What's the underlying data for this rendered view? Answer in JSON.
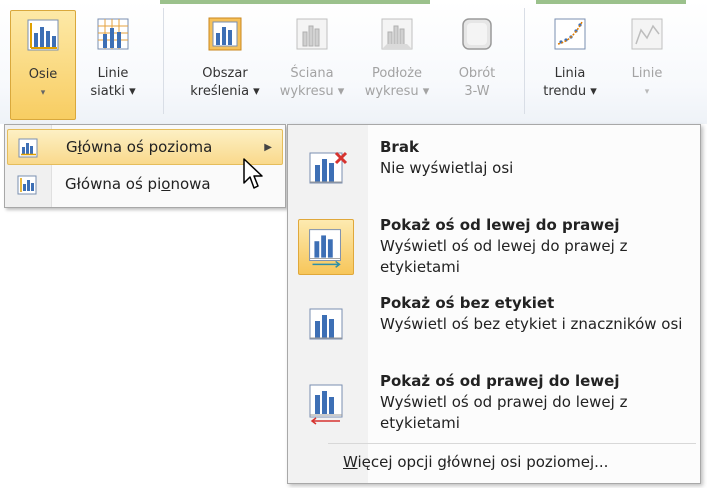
{
  "ribbon": {
    "buttons": [
      {
        "id": "osie",
        "line1": "Osie",
        "line2": "▾",
        "state": "active"
      },
      {
        "id": "linie-siatki",
        "line1": "Linie",
        "line2": "siatki ▾",
        "state": "normal"
      },
      {
        "id": "obszar",
        "line1": "Obszar",
        "line2": "kreślenia ▾",
        "state": "normal"
      },
      {
        "id": "sciana",
        "line1": "Ściana",
        "line2": "wykresu ▾",
        "state": "disabled"
      },
      {
        "id": "podloze",
        "line1": "Podłoże",
        "line2": "wykresu ▾",
        "state": "disabled"
      },
      {
        "id": "obrot",
        "line1": "Obrót",
        "line2": "3-W",
        "state": "disabled"
      },
      {
        "id": "linia-trendu",
        "line1": "Linia",
        "line2": "trendu ▾",
        "state": "normal"
      },
      {
        "id": "linie",
        "line1": "Linie",
        "line2": "▾",
        "state": "disabled"
      }
    ]
  },
  "menu": {
    "items": [
      {
        "label_pre": "G",
        "label_u": "ł",
        "label_post": "ówna oś pozioma",
        "has_submenu": true,
        "hot": true
      },
      {
        "label_pre": "Główna oś pi",
        "label_u": "o",
        "label_post": "nowa",
        "has_submenu": false,
        "hot": false
      }
    ]
  },
  "submenu": {
    "items": [
      {
        "title": "Brak",
        "desc": "Nie wyświetlaj osi",
        "selected": false
      },
      {
        "title": "Pokaż oś od lewej do prawej",
        "desc": "Wyświetl oś od lewej do prawej z etykietami",
        "selected": true
      },
      {
        "title": "Pokaż oś bez etykiet",
        "desc": "Wyświetl oś bez etykiet i znaczników osi",
        "selected": false
      },
      {
        "title": "Pokaż oś od prawej do lewej",
        "desc": "Wyświetl oś od prawej do lewej z etykietami",
        "selected": false
      }
    ],
    "more": {
      "pre": "",
      "u": "W",
      "post": "ięcej opcji głównej osi poziomej..."
    }
  },
  "colors": {
    "accent": "#f8cd62",
    "chart_bar": "#3d6fb5",
    "red_x": "#d6332f",
    "teal": "#2e8fa8"
  }
}
